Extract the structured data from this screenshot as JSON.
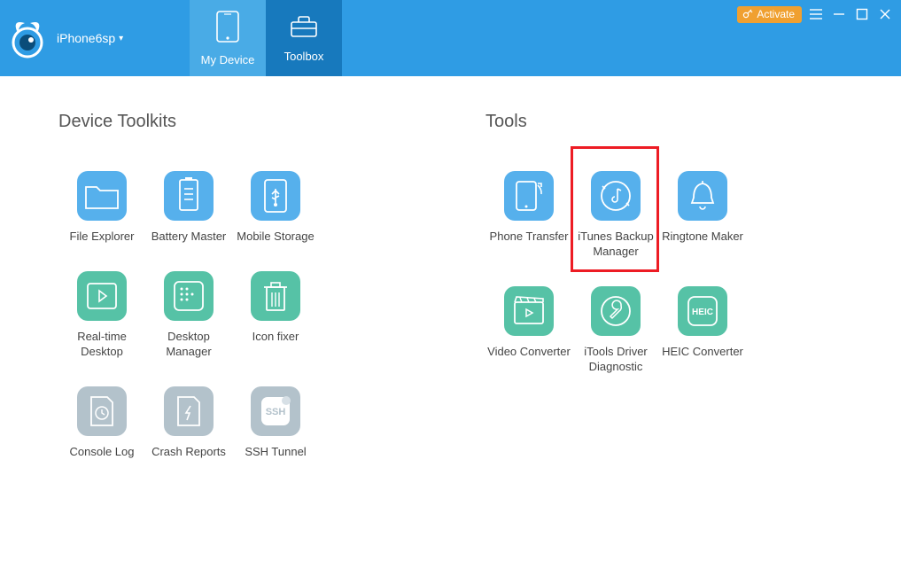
{
  "header": {
    "device_name": "iPhone6sp",
    "tabs": [
      {
        "label": "My Device"
      },
      {
        "label": "Toolbox"
      }
    ],
    "activate_label": "Activate"
  },
  "sections": {
    "left": {
      "title": "Device Toolkits",
      "items": [
        {
          "label": "File Explorer",
          "icon": "folder-icon",
          "color": "blue"
        },
        {
          "label": "Battery Master",
          "icon": "battery-icon",
          "color": "blue"
        },
        {
          "label": "Mobile Storage",
          "icon": "usb-icon",
          "color": "blue"
        },
        {
          "label": "Real-time Desktop",
          "icon": "play-window-icon",
          "color": "teal"
        },
        {
          "label": "Desktop Manager",
          "icon": "grid-icon",
          "color": "teal"
        },
        {
          "label": "Icon fixer",
          "icon": "trash-icon",
          "color": "teal"
        },
        {
          "label": "Console Log",
          "icon": "clock-file-icon",
          "color": "gray"
        },
        {
          "label": "Crash Reports",
          "icon": "crash-file-icon",
          "color": "gray"
        },
        {
          "label": "SSH Tunnel",
          "icon": "ssh-icon",
          "color": "gray"
        }
      ]
    },
    "right": {
      "title": "Tools",
      "items": [
        {
          "label": "Phone Transfer",
          "icon": "phone-transfer-icon",
          "color": "blue"
        },
        {
          "label": "iTunes Backup Manager",
          "icon": "music-refresh-icon",
          "color": "blue",
          "highlight": true
        },
        {
          "label": "Ringtone Maker",
          "icon": "bell-icon",
          "color": "blue"
        },
        {
          "label": "Video Converter",
          "icon": "clapper-play-icon",
          "color": "teal"
        },
        {
          "label": "iTools Driver Diagnostic",
          "icon": "wrench-circle-icon",
          "color": "teal"
        },
        {
          "label": "HEIC Converter",
          "icon": "heic-icon",
          "color": "teal"
        }
      ]
    }
  }
}
